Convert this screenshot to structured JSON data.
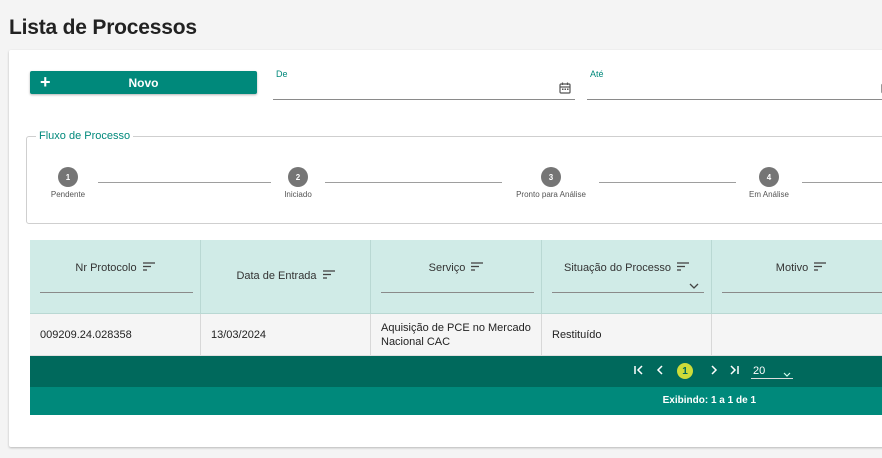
{
  "page": {
    "title": "Lista de Processos"
  },
  "toolbar": {
    "new_label": "Novo",
    "plus_glyph": "+"
  },
  "filters": {
    "from_label": "De",
    "to_label": "Até",
    "from_value": "",
    "to_value": ""
  },
  "flow": {
    "legend": "Fluxo de Processo",
    "steps": [
      {
        "number": "1",
        "label": "Pendente"
      },
      {
        "number": "2",
        "label": "Iniciado"
      },
      {
        "number": "3",
        "label": "Pronto para Análise"
      },
      {
        "number": "4",
        "label": "Em Análise"
      }
    ]
  },
  "table": {
    "columns": [
      "Nr Protocolo",
      "Data de Entrada",
      "Serviço",
      "Situação do Processo",
      "Motivo"
    ],
    "rows": [
      {
        "protocolo": "009209.24.028358",
        "data": "13/03/2024",
        "servico": "Aquisição de PCE no Mercado Nacional CAC",
        "situacao": "Restituído",
        "motivo": ""
      }
    ]
  },
  "pagination": {
    "current_page": "1",
    "page_size": "20",
    "info": "Exibindo: 1 a 1 de 1"
  },
  "colors": {
    "primary": "#00897b",
    "primary_dark": "#00695c",
    "header_bg": "#d0ebe7",
    "accent": "#cddc39"
  },
  "icons": [
    "plus-icon",
    "calendar-icon",
    "sort-icon",
    "chevron-down-icon",
    "first-page-icon",
    "prev-page-icon",
    "next-page-icon",
    "last-page-icon"
  ]
}
